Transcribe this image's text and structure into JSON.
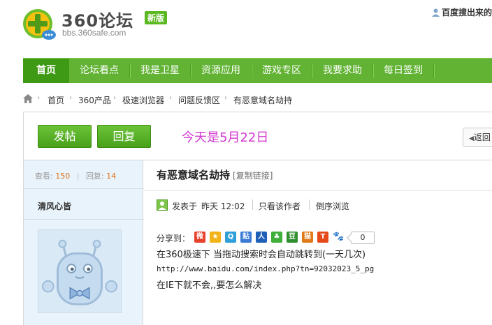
{
  "header": {
    "logo_text": "360论坛",
    "logo_badge": "新版",
    "logo_sub": "bbs.360safe.com",
    "right_text": "百度搜出来的"
  },
  "nav": {
    "items": [
      {
        "label": "首页",
        "active": true
      },
      {
        "label": "论坛看点"
      },
      {
        "label": "我是卫星"
      },
      {
        "label": "资源应用"
      },
      {
        "label": "游戏专区"
      },
      {
        "label": "我要求助"
      },
      {
        "label": "每日签到"
      }
    ]
  },
  "breadcrumb": {
    "items": [
      "首页",
      "360产品",
      "极速浏览器",
      "问题反馈区",
      "有恶意域名劫持"
    ]
  },
  "toolbar": {
    "post_label": "发帖",
    "reply_label": "回复",
    "today_text": "今天是5月22日",
    "back_label": "返回"
  },
  "sidebar": {
    "views_label": "查看:",
    "views_value": "150",
    "sep": "|",
    "replies_label": "回复:",
    "replies_value": "14",
    "author": "清风心皆"
  },
  "post": {
    "title": "有恶意域名劫持",
    "copy_link": "[复制链接]",
    "meta_posted": "发表于",
    "meta_time": "昨天 12:02",
    "meta_author_only": "只看该作者",
    "meta_reverse": "倒序浏览",
    "share_label": "分享到：",
    "share_count": "0",
    "lines": [
      "在360极速下 当拖动搜索时会自动跳转到(一天几次)",
      "http://www.baidu.com/index.php?tn=92032023_5_pg",
      "在IE下就不会,,要怎么解决"
    ]
  },
  "colors": {
    "nav_bg": "#62b334",
    "nav_active": "#3e9a14",
    "today_text": "#d23ad0",
    "stat_number": "#e07018",
    "sidebar_bg": "#e8f3fb"
  },
  "icons": {
    "share_icons": [
      "sina-weibo-icon",
      "qzone-icon",
      "tencent-weibo-icon",
      "baidu-tieba-icon",
      "renren-icon",
      "kaixin-icon",
      "douban-icon",
      "mop-icon",
      "taobao-icon",
      "baidu-icon"
    ]
  }
}
